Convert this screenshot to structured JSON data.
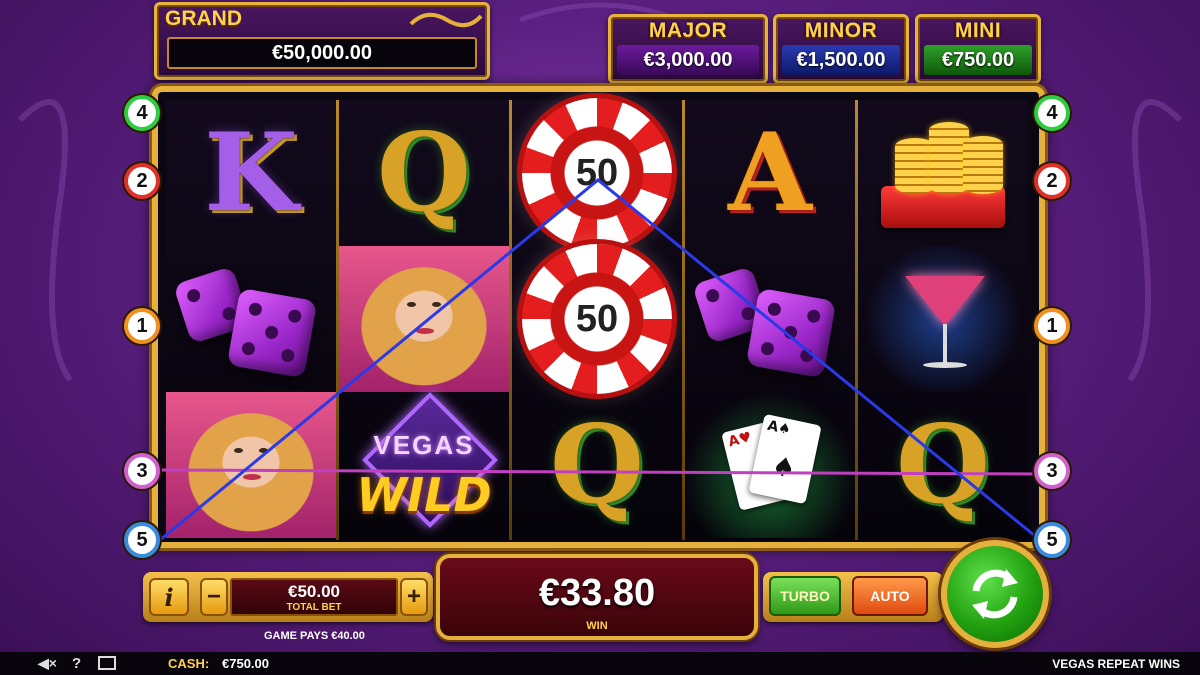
{
  "jackpots": {
    "grand": {
      "title": "GRAND",
      "value": "€50,000.00"
    },
    "major": {
      "title": "MAJOR",
      "value": "€3,000.00"
    },
    "minor": {
      "title": "MINOR",
      "value": "€1,500.00"
    },
    "mini": {
      "title": "MINI",
      "value": "€750.00"
    }
  },
  "reels": [
    [
      "K",
      "dice",
      "woman"
    ],
    [
      "Q",
      "woman",
      "vegas-wild"
    ],
    [
      "chip-50",
      "chip-50",
      "Q"
    ],
    [
      "A",
      "dice",
      "cards"
    ],
    [
      "coins",
      "cocktail",
      "Q"
    ]
  ],
  "chip_label": "50",
  "vegas_logo": {
    "top": "VEGAS",
    "bottom": "WILD"
  },
  "paylines": {
    "left": [
      "4",
      "2",
      "1",
      "3",
      "5"
    ],
    "right": [
      "4",
      "2",
      "1",
      "3",
      "5"
    ],
    "colors": {
      "1": "#f09020",
      "2": "#e0302a",
      "3": "#d060d0",
      "4": "#2ecc40",
      "5": "#3a8ae0"
    }
  },
  "controls": {
    "info_icon": "i",
    "minus": "−",
    "plus": "+",
    "total_bet_value": "€50.00",
    "total_bet_label": "TOTAL BET",
    "game_pays": "GAME PAYS €40.00",
    "win_value": "€33.80",
    "win_label": "WIN",
    "turbo": "TURBO",
    "auto": "AUTO"
  },
  "footer": {
    "cash_label": "CASH:",
    "cash_value": "€750.00",
    "game_title": "VEGAS REPEAT WINS",
    "help": "?"
  },
  "icons": [
    "sound-icon",
    "help-icon",
    "fullscreen-icon",
    "spin-refresh-icon",
    "info-icon"
  ]
}
